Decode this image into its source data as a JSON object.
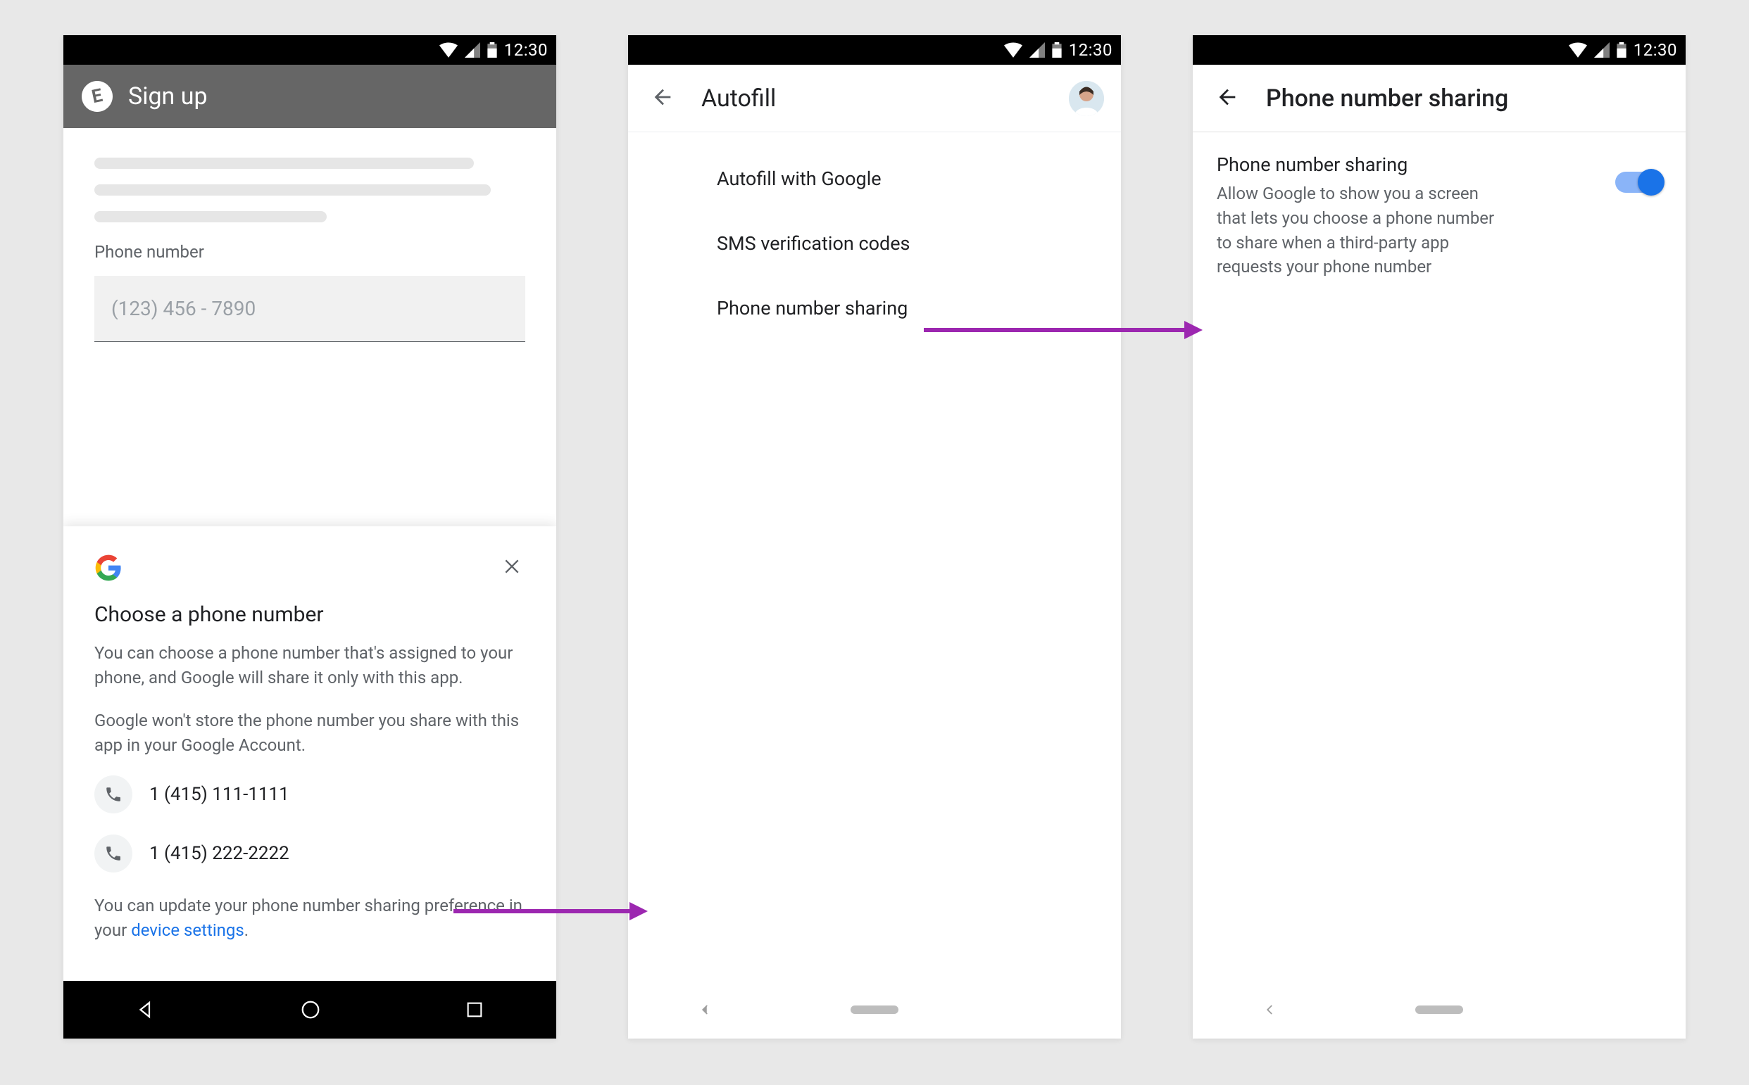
{
  "status": {
    "time": "12:30"
  },
  "screen1": {
    "header_title": "Sign up",
    "field_label": "Phone number",
    "phone_placeholder": "(123) 456 - 7890",
    "sheet": {
      "title": "Choose a phone number",
      "p1": "You can choose a phone number that's assigned to your phone, and Google will share it only with this app.",
      "p2": "Google won't store the phone number you share with this app in your Google Account.",
      "numbers": [
        "1 (415) 111-1111",
        "1 (415) 222-2222"
      ],
      "footer_pre": "You can update your phone number sharing preference in your ",
      "footer_link": "device settings",
      "footer_post": "."
    }
  },
  "screen2": {
    "title": "Autofill",
    "items": [
      "Autofill with Google",
      "SMS verification codes",
      "Phone number sharing"
    ]
  },
  "screen3": {
    "title": "Phone number sharing",
    "card_title": "Phone number sharing",
    "card_desc": "Allow Google to show you a screen that lets you choose a phone number to share when a third-party app requests your phone number"
  }
}
